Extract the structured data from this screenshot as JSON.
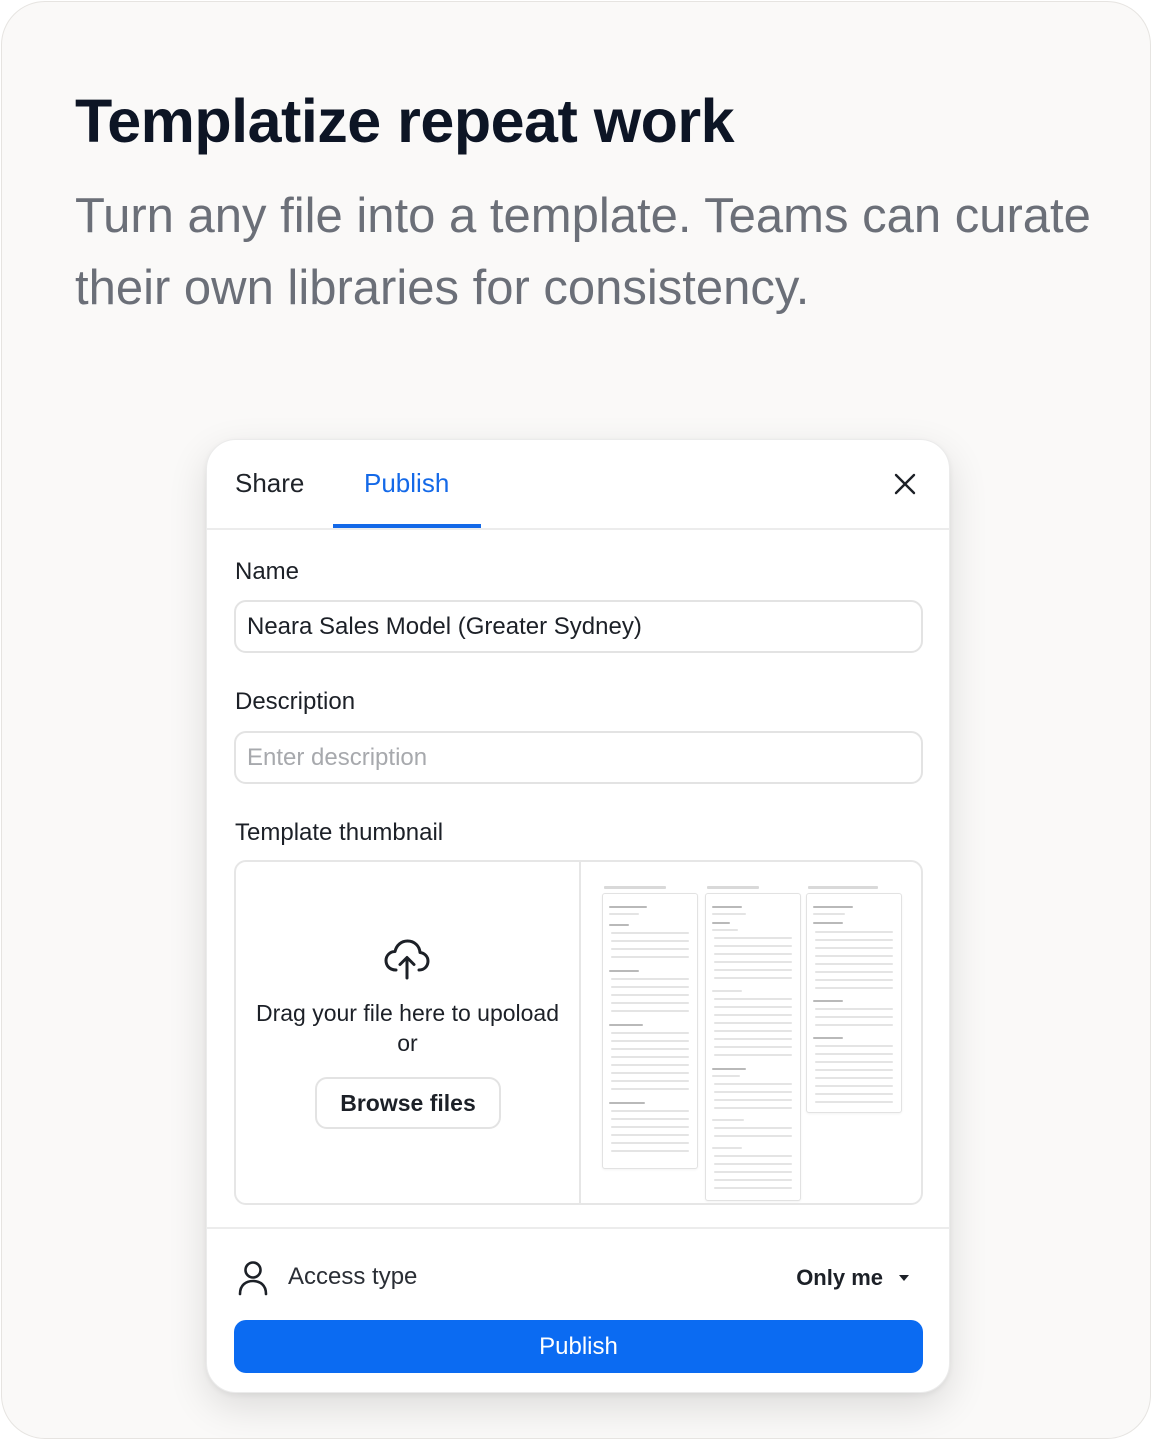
{
  "hero": {
    "title": "Templatize repeat work",
    "subtitle": "Turn any file into a template. Teams can curate their own libraries for consistency."
  },
  "dialog": {
    "tabs": [
      {
        "label": "Share",
        "active": false
      },
      {
        "label": "Publish",
        "active": true
      }
    ],
    "name": {
      "label": "Name",
      "value": "Neara Sales Model (Greater Sydney)"
    },
    "description": {
      "label": "Description",
      "placeholder": "Enter description"
    },
    "thumbnail": {
      "label": "Template thumbnail",
      "drag_text": "Drag your file here to upoload",
      "or_text": "or",
      "browse_label": "Browse files"
    },
    "access": {
      "label": "Access type",
      "value": "Only me"
    },
    "publish_label": "Publish"
  },
  "colors": {
    "accent": "#1469e8",
    "primary_button": "#0b6bf2",
    "title_text": "#0d1525",
    "subtitle_text": "#6b6f78"
  },
  "icons": {
    "close": "close-icon",
    "upload": "cloud-upload-icon",
    "person": "person-icon",
    "caret": "caret-down-icon"
  }
}
